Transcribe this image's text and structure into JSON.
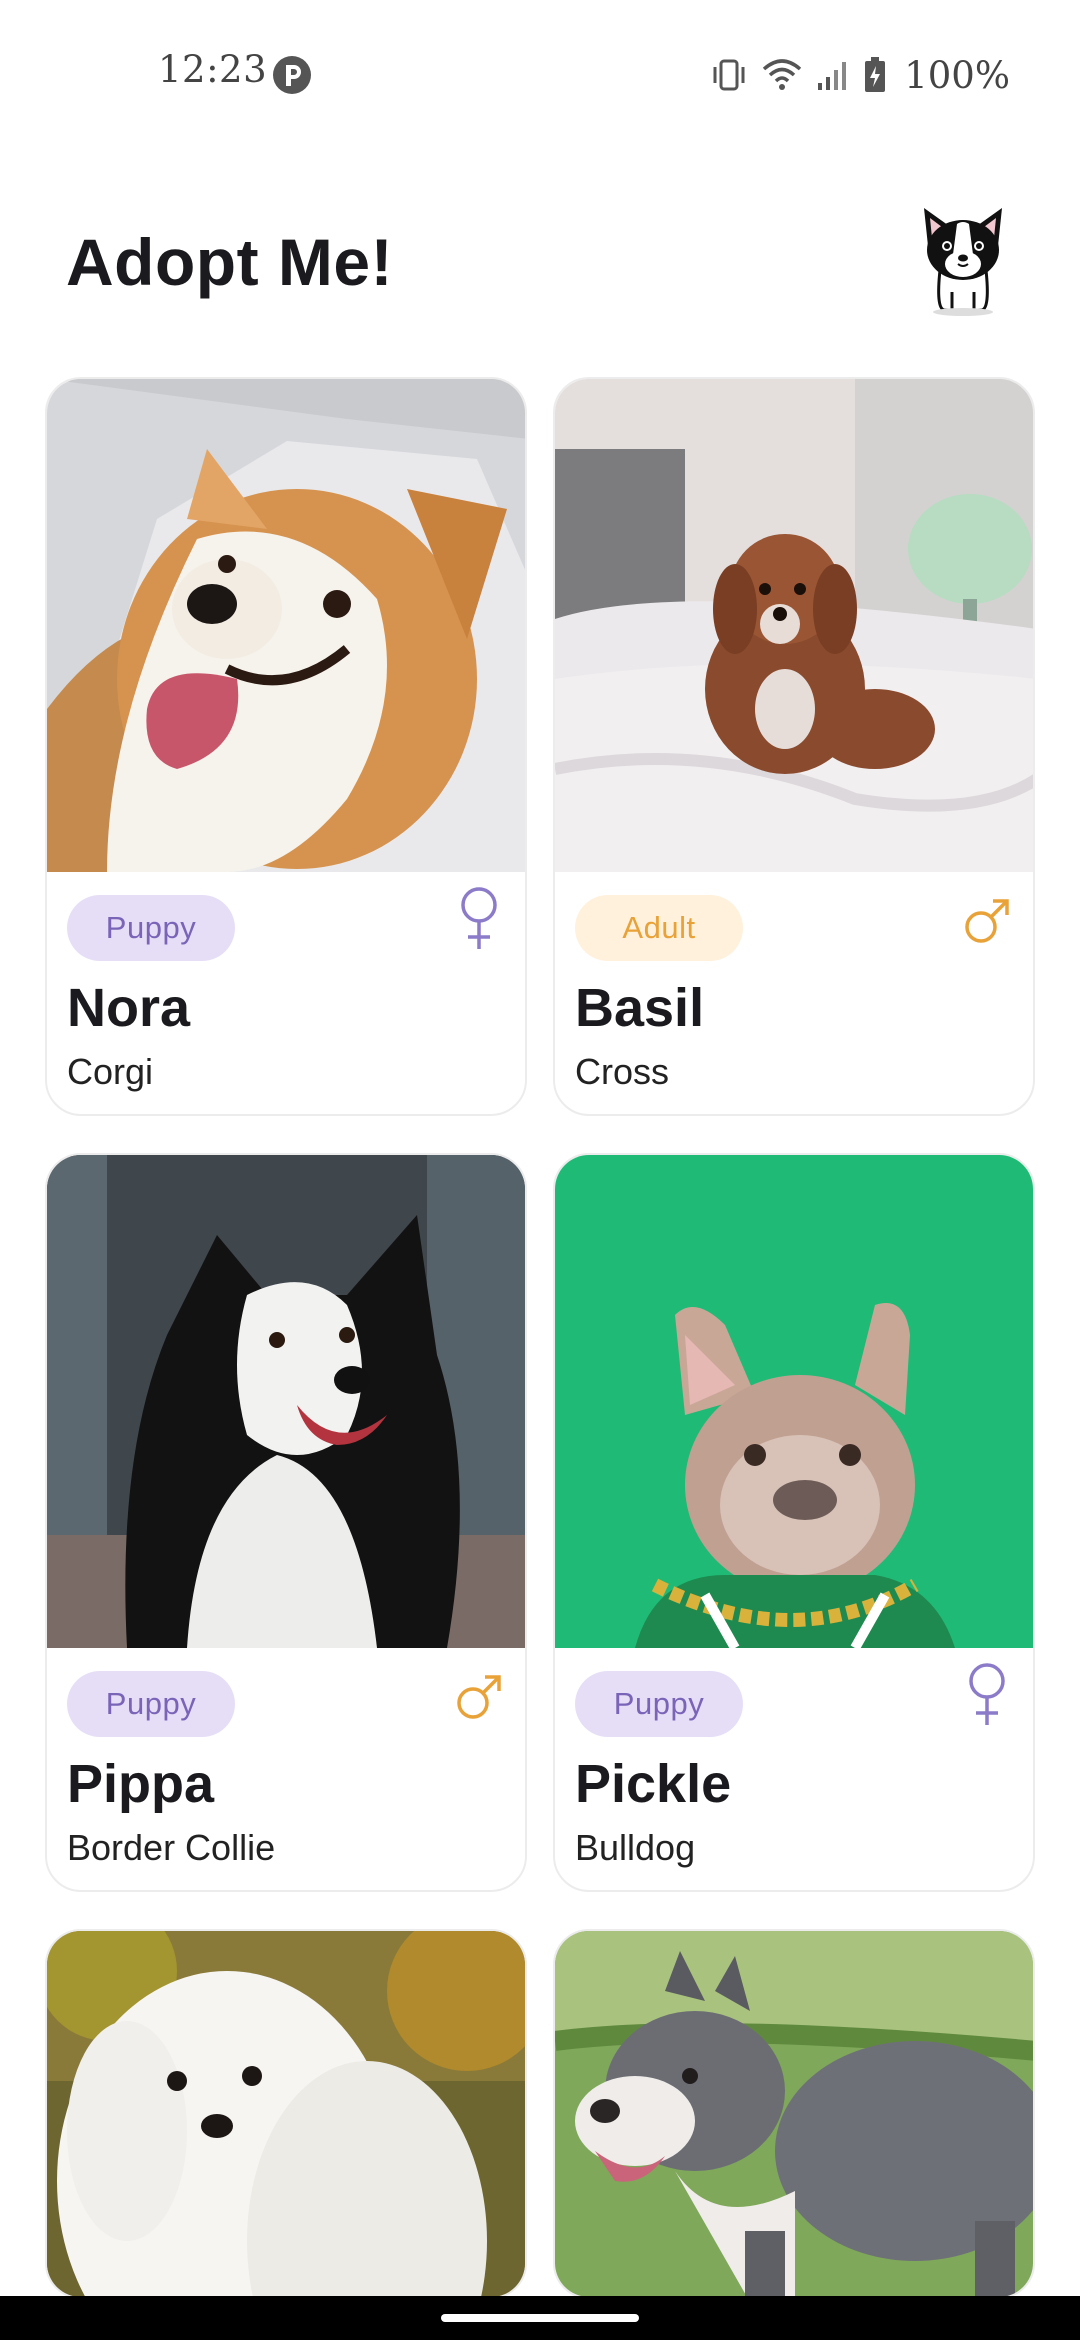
{
  "status_bar": {
    "time": "12:23",
    "battery_text": "100%"
  },
  "header": {
    "title": "Adopt Me!"
  },
  "colors": {
    "puppy_badge_bg": "#e6def7",
    "puppy_badge_text": "#7a64b8",
    "adult_badge_bg": "#fff1dc",
    "adult_badge_text": "#e8a238",
    "female_icon": "#8c7bc8",
    "male_icon": "#e8a238"
  },
  "pets": [
    {
      "name": "Nora",
      "breed": "Corgi",
      "age": "Puppy",
      "gender": "female-icon"
    },
    {
      "name": "Basil",
      "breed": "Cross",
      "age": "Adult",
      "gender": "male-icon"
    },
    {
      "name": "Pippa",
      "breed": "Border Collie",
      "age": "Puppy",
      "gender": "male-icon"
    },
    {
      "name": "Pickle",
      "breed": "Bulldog",
      "age": "Puppy",
      "gender": "female-icon"
    }
  ]
}
